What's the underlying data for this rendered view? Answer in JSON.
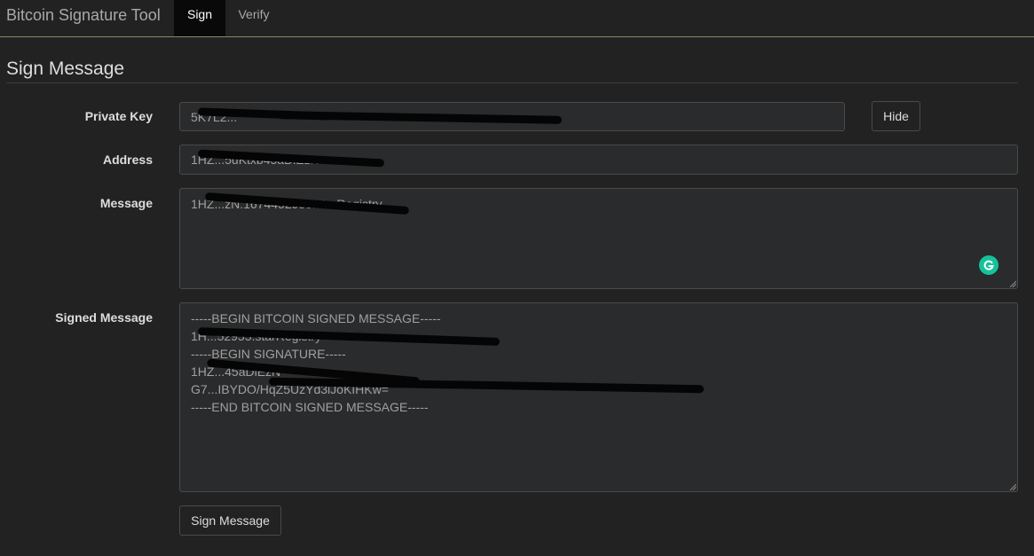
{
  "nav": {
    "brand": "Bitcoin Signature Tool",
    "tabs": [
      {
        "label": "Sign",
        "active": true
      },
      {
        "label": "Verify",
        "active": false
      }
    ]
  },
  "main": {
    "title": "Sign Message",
    "private_key": {
      "label": "Private Key",
      "value": "5K7L2...",
      "hide_button": "Hide"
    },
    "address": {
      "label": "Address",
      "value": "1HZ...5uKtxb45aDiEzN"
    },
    "message": {
      "label": "Message",
      "value": "1HZ...zN:1674452955:starRegistry"
    },
    "signed_message": {
      "label": "Signed Message",
      "lines": [
        "-----BEGIN BITCOIN SIGNED MESSAGE-----",
        "1H...52955:starRegistry",
        "-----BEGIN SIGNATURE-----",
        "1HZ...45aDiEzN",
        "G7...IBYDO/HqZ5UzYd3iJoKIHKw=",
        "-----END BITCOIN SIGNED MESSAGE-----"
      ]
    },
    "sign_button": "Sign Message"
  },
  "colors": {
    "background": "#222222",
    "field_bg": "#2a2b2c",
    "grammarly": "#15c39a"
  },
  "icons": [
    "grammarly-icon",
    "resize-grip-icon"
  ]
}
